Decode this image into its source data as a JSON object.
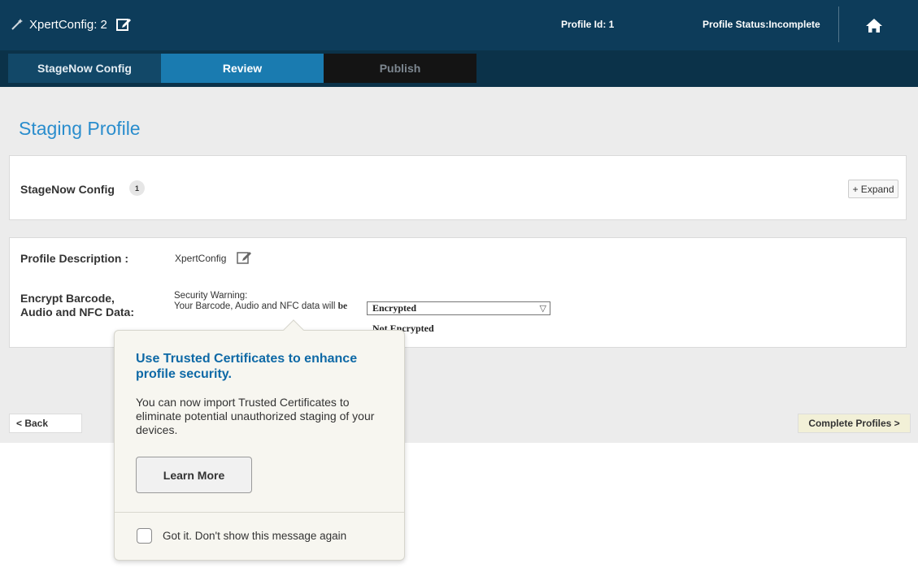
{
  "header": {
    "app_title": "XpertConfig: 2",
    "profile_id": "Profile Id: 1",
    "profile_status": "Profile Status:Incomplete"
  },
  "stepper": {
    "steps": [
      {
        "label": "StageNow Config",
        "state": "done"
      },
      {
        "label": "Review",
        "state": "active"
      },
      {
        "label": "Publish",
        "state": "disabled"
      }
    ]
  },
  "main": {
    "page_title": "Staging Profile",
    "stagenow_section": {
      "label": "StageNow Config",
      "count": "1",
      "expand_label": "+ Expand"
    },
    "profile": {
      "description_label": "Profile Description :",
      "description_value": "XpertConfig",
      "encrypt_label": "Encrypt Barcode, Audio and NFC Data:",
      "warning_line1": "Security Warning:",
      "warning_line2": "Your Barcode, Audio and NFC data will",
      "warning_be": "be",
      "selected": "Encrypted",
      "options": [
        "Encrypted",
        "Not Encrypted"
      ],
      "visible_option": "Not Encrypted"
    },
    "back_label": "< Back",
    "complete_label": "Complete Profiles >"
  },
  "popup": {
    "title": "Use Trusted Certificates to enhance profile security.",
    "body": "You can now import Trusted Certificates to eliminate potential unauthorized staging of your devices.",
    "learn_more": "Learn More",
    "gotit": "Got it. Don't show this message again",
    "gotit_checked": false
  },
  "colors": {
    "header_bg": "#0d3c5a",
    "step_active": "#1a7bb0",
    "title_blue": "#2a8dcd",
    "popup_title": "#0e69a6",
    "complete_btn_bg": "#f2f0d7"
  },
  "icons": [
    "magic-wand-icon",
    "edit-icon",
    "home-icon",
    "dropdown-arrow-icon"
  ]
}
